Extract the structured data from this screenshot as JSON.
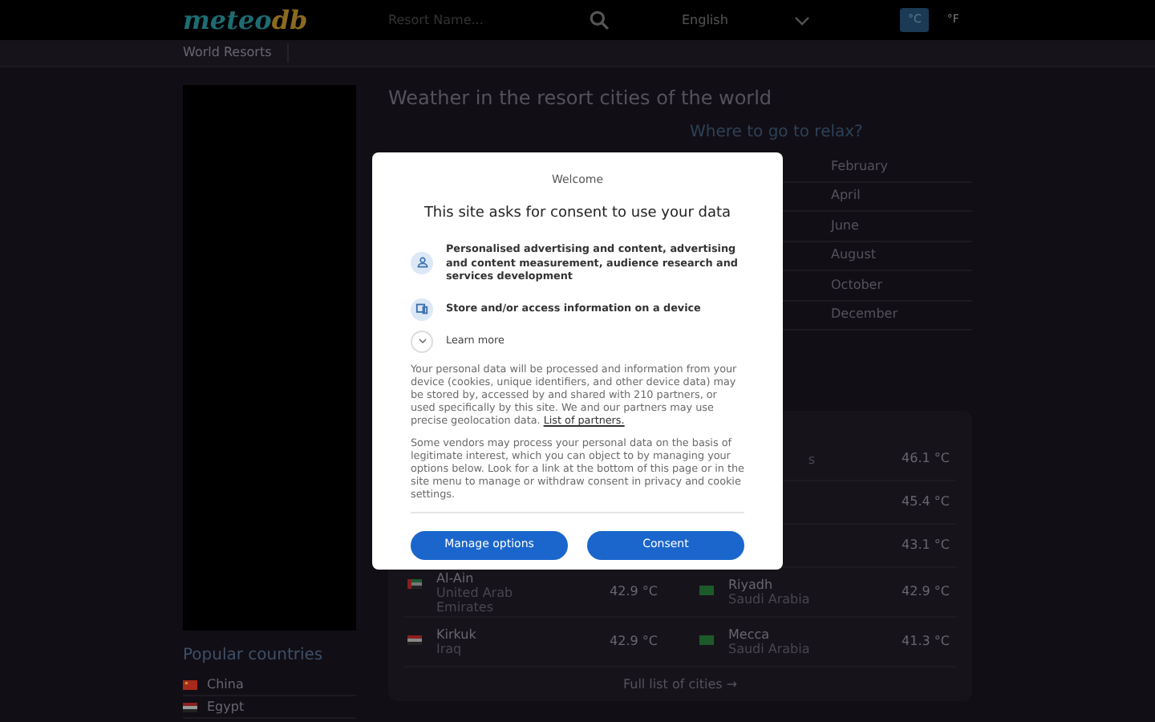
{
  "header": {
    "logo_left": "meteo",
    "logo_right": "db",
    "search": {
      "placeholder": "Resort Name..."
    },
    "language": "English",
    "units": [
      {
        "label": "°C",
        "selected": true
      },
      {
        "label": "°F",
        "selected": false
      }
    ]
  },
  "subnav": {
    "items": [
      "World Resorts"
    ]
  },
  "main": {
    "title": "Weather in the resort cities of the world",
    "relax": {
      "title": "Where to go to relax?",
      "months": [
        "February",
        "April",
        "June",
        "August",
        "October",
        "December"
      ]
    },
    "hottest": {
      "rows": [
        {
          "right": {
            "country": "s",
            "temp": "46.1 °C"
          }
        },
        {
          "right": {
            "temp": "45.4 °C"
          }
        },
        {
          "right": {
            "temp": "43.1 °C"
          }
        },
        {
          "left": {
            "city": "Al-Ain",
            "country": "United Arab Emirates",
            "temp": "42.9 °C",
            "kind": "uae"
          },
          "right": {
            "city": "Riyadh",
            "country": "Saudi Arabia",
            "temp": "42.9 °C",
            "kind": "saudi"
          }
        },
        {
          "left": {
            "city": "Kirkuk",
            "country": "Iraq",
            "temp": "42.9 °C",
            "kind": "iraq"
          },
          "right": {
            "city": "Mecca",
            "country": "Saudi Arabia",
            "temp": "41.3 °C",
            "kind": "saudi"
          }
        }
      ],
      "link": "Full list of cities →"
    }
  },
  "sidebar": {
    "title": "Popular countries",
    "countries": [
      {
        "name": "China",
        "kind": "china"
      },
      {
        "name": "Egypt",
        "kind": "egypt"
      }
    ]
  },
  "consent": {
    "welcome": "Welcome",
    "title": "This site asks for consent to use your data",
    "purposes": [
      {
        "kind": "person",
        "text": "Personalised advertising and content, advertising and content measurement, audience research and services development"
      },
      {
        "kind": "device",
        "text": "Store and/or access information on a device"
      }
    ],
    "learn_more": "Learn more",
    "paragraph_1": "Your personal data will be processed and information from your device (cookies, unique identifiers, and other device data) may be stored by, accessed by and shared with 210 partners, or used specifically by this site. We and our partners may use precise geolocation data.",
    "partners_link": "List of partners.",
    "paragraph_2": "Some vendors may process your personal data on the basis of legitimate interest, which you can object to by managing your options below. Look for a link at the bottom of this page or in the site menu to manage or withdraw consent in privacy and cookie settings.",
    "buttons": [
      "Manage options",
      "Consent"
    ]
  }
}
